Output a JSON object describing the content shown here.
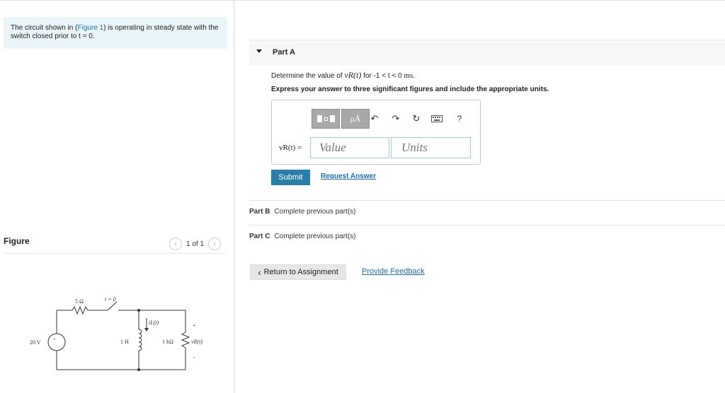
{
  "problem": {
    "text_before": "The circuit shown in (",
    "figure_link": "Figure 1",
    "text_after": ") is operating in steady state with the switch closed prior to t = 0."
  },
  "figure": {
    "label": "Figure",
    "counter": "1 of 1",
    "prev_icon": "chevron-left-icon",
    "next_icon": "chevron-right-icon",
    "circuit": {
      "source": "20 V",
      "resistor": "5 Ω",
      "switch": "t = 0",
      "inductor": "1 H",
      "current": "iL(t)",
      "load": "1 kΩ",
      "voltage": "vR(t)",
      "plus": "+",
      "minus": "-"
    }
  },
  "partA": {
    "title": "Part A",
    "question_prefix": "Determine the value of ",
    "question_var": "vR(t)",
    "question_mid": " for -1 < t < 0 ",
    "question_unit": "ms",
    "question_end": ".",
    "instruction": "Express your answer to three significant figures and include the appropriate units.",
    "toolbar": {
      "units_label": "μÅ",
      "undo_icon": "undo-icon",
      "redo_icon": "redo-icon",
      "reset_icon": "reset-icon",
      "keyboard_icon": "keyboard-icon",
      "help_label": "?"
    },
    "var_label": "vR(t) =",
    "value_placeholder": "Value",
    "units_placeholder": "Units",
    "submit_label": "Submit",
    "request_label": "Request Answer"
  },
  "partB": {
    "title": "Part B",
    "status": "Complete previous part(s)"
  },
  "partC": {
    "title": "Part C",
    "status": "Complete previous part(s)"
  },
  "footer": {
    "return_label": "Return to Assignment",
    "feedback_label": "Provide Feedback"
  }
}
